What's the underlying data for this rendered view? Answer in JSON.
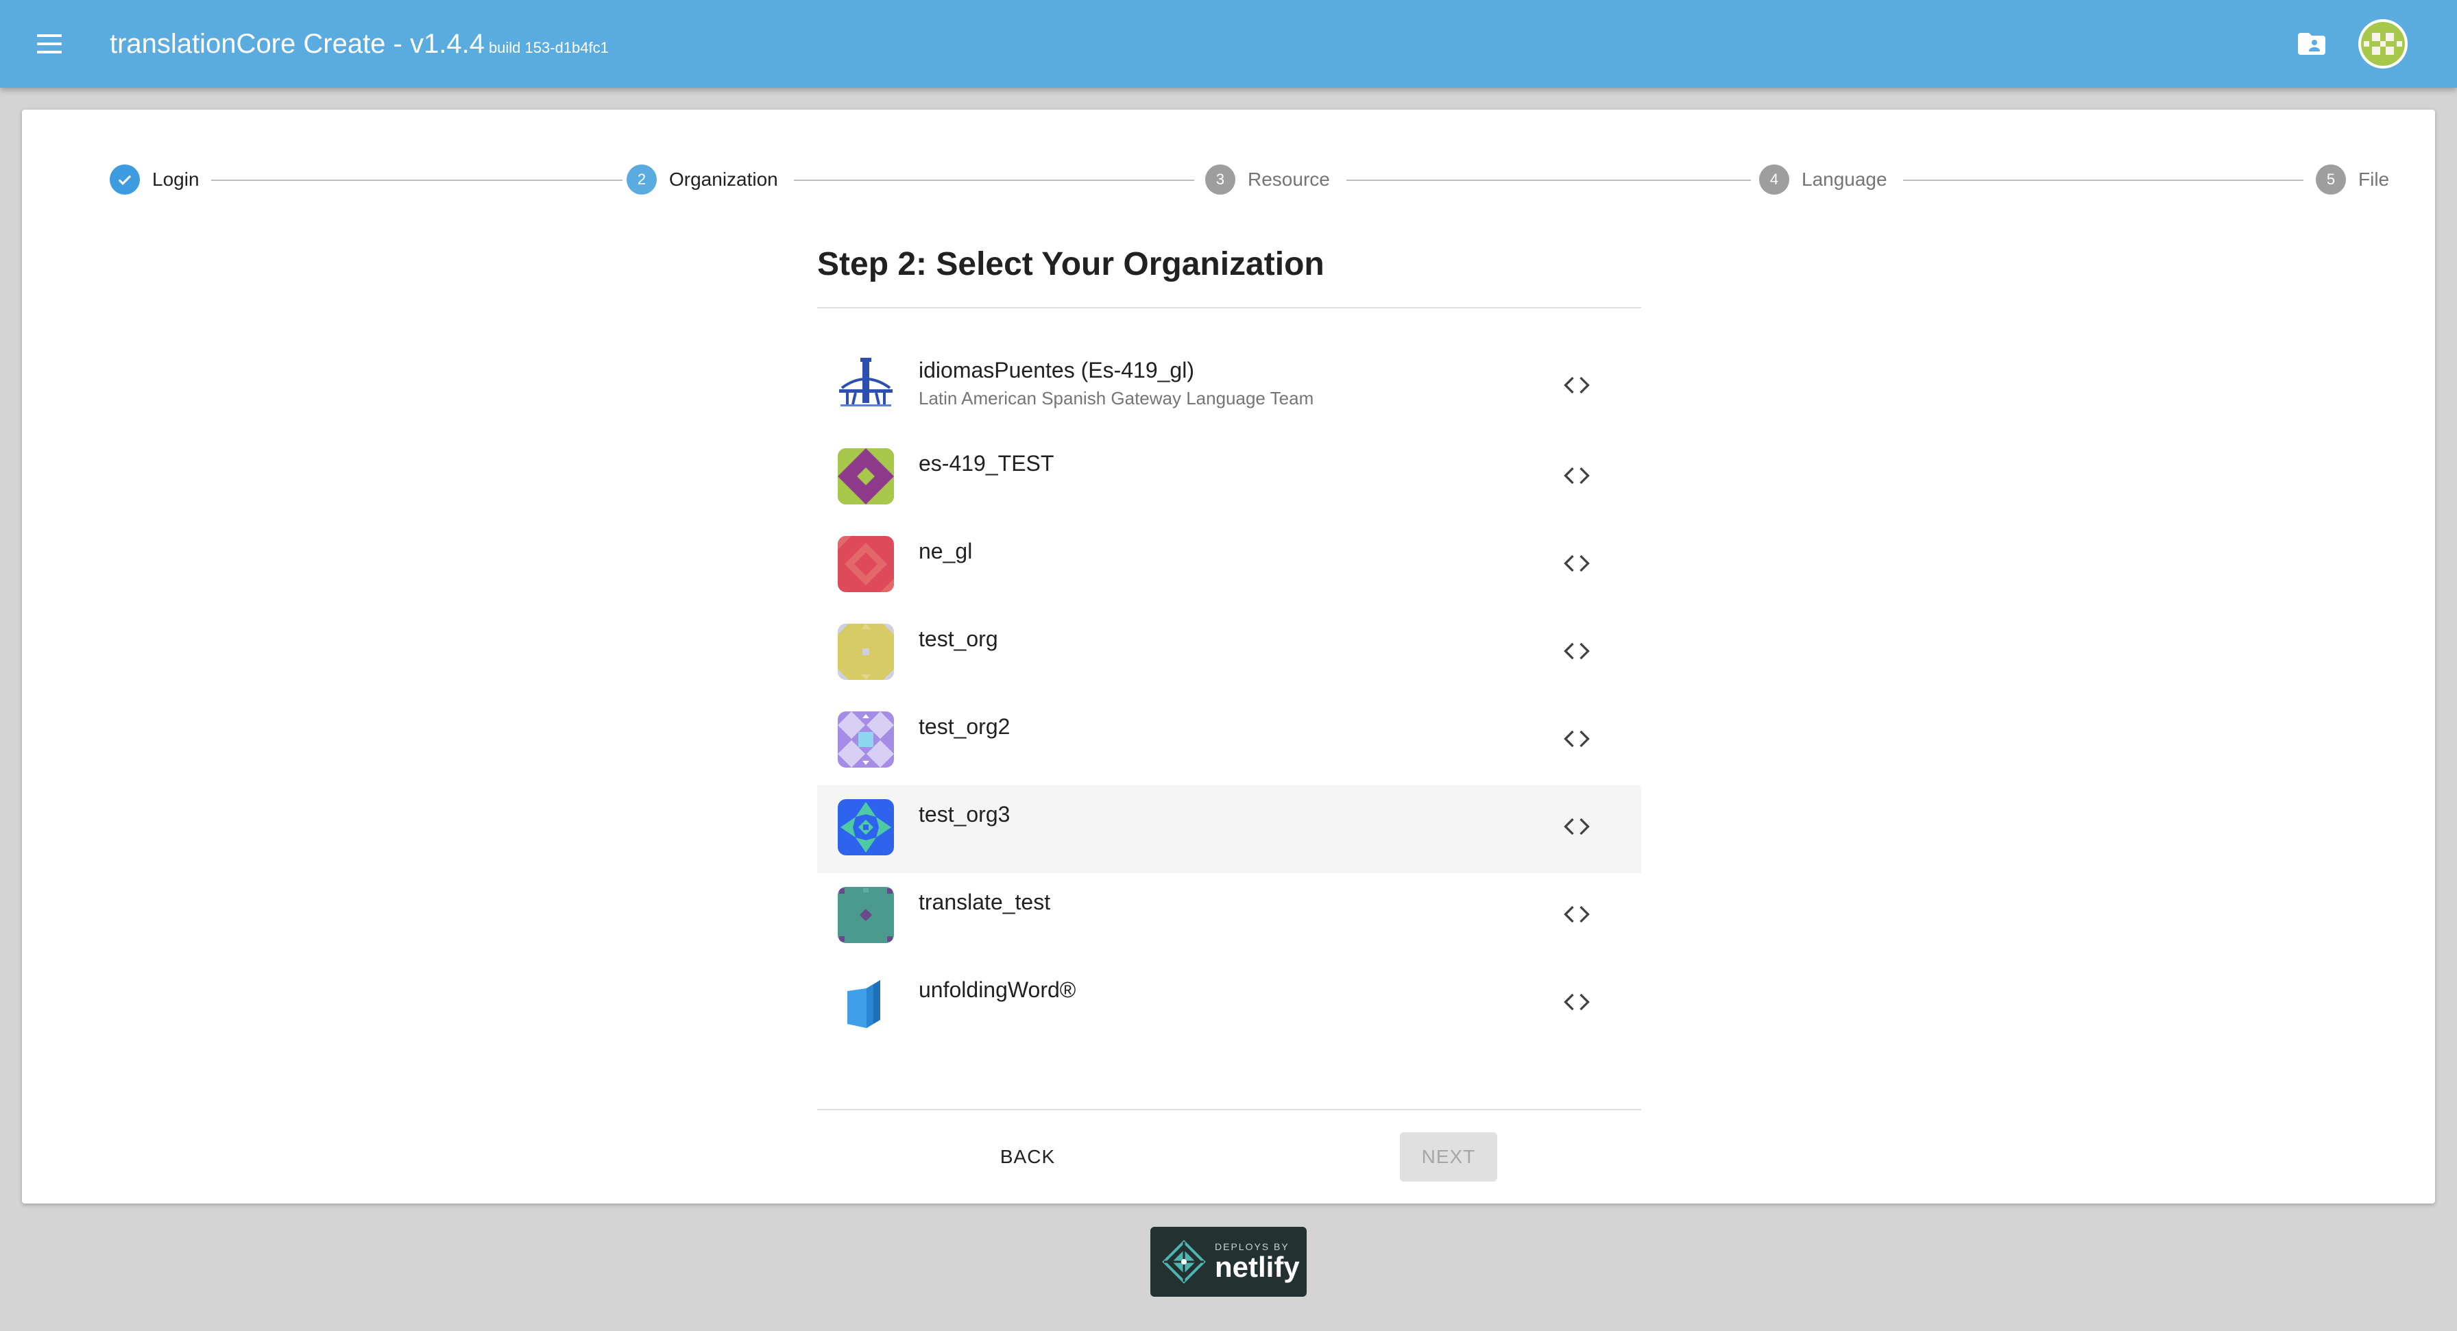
{
  "app": {
    "title": "translationCore Create - v1.4.4",
    "build": "build 153-d1b4fc1",
    "colors": {
      "appbar": "#5aace0",
      "accent": "#3d9be0"
    }
  },
  "stepper": {
    "steps": [
      {
        "number": "",
        "label": "Login",
        "state": "completed"
      },
      {
        "number": "2",
        "label": "Organization",
        "state": "active"
      },
      {
        "number": "3",
        "label": "Resource",
        "state": "pending"
      },
      {
        "number": "4",
        "label": "Language",
        "state": "pending"
      },
      {
        "number": "5",
        "label": "File",
        "state": "pending"
      }
    ]
  },
  "main": {
    "heading": "Step 2: Select Your Organization",
    "organizations": [
      {
        "name": "idiomasPuentes (Es-419_gl)",
        "description": "Latin American Spanish Gateway Language Team",
        "avatar": "bridge-logo"
      },
      {
        "name": "es-419_TEST",
        "description": "",
        "avatar": "identicon-purple-green"
      },
      {
        "name": "ne_gl",
        "description": "",
        "avatar": "identicon-red"
      },
      {
        "name": "test_org",
        "description": "",
        "avatar": "identicon-yellow"
      },
      {
        "name": "test_org2",
        "description": "",
        "avatar": "identicon-lavender"
      },
      {
        "name": "test_org3",
        "description": "",
        "avatar": "identicon-blue-green"
      },
      {
        "name": "translate_test",
        "description": "",
        "avatar": "identicon-teal"
      },
      {
        "name": "unfoldingWord®",
        "description": "",
        "avatar": "unfoldingword-logo"
      }
    ],
    "hovered_index": 5
  },
  "actions": {
    "back_label": "BACK",
    "next_label": "NEXT",
    "next_disabled": true
  },
  "footer": {
    "netlify_small": "DEPLOYS BY",
    "netlify_big": "netlify"
  }
}
